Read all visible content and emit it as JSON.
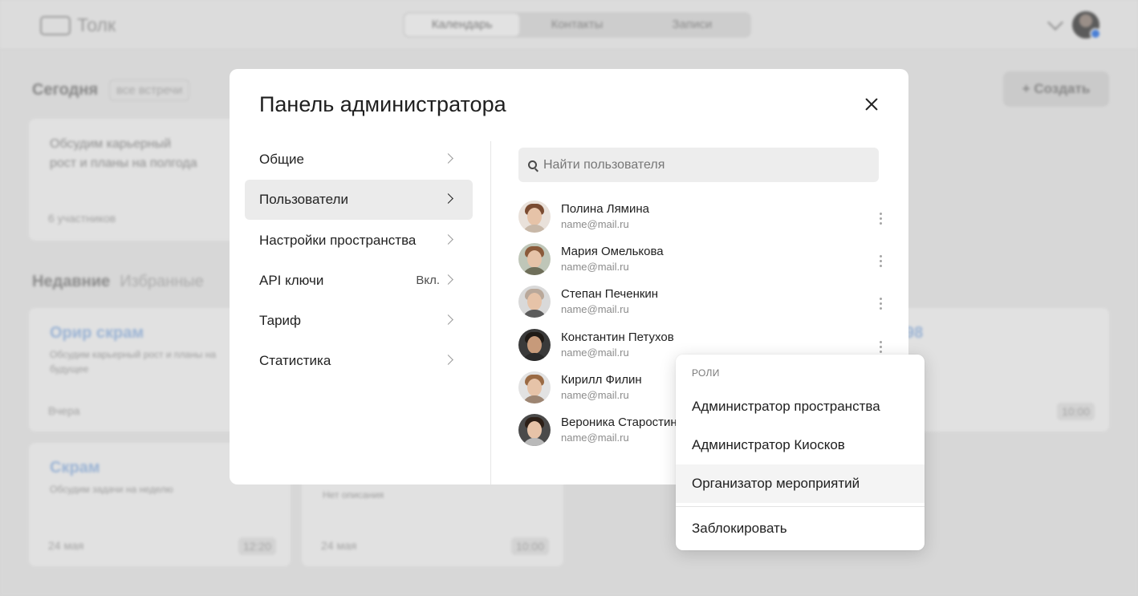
{
  "app": {
    "logo_text": "Толк",
    "tabs": [
      "Календарь",
      "Контакты",
      "Записи"
    ],
    "today_label": "Сегодня",
    "filter_label": "все встречи",
    "create_label": "+ Создать",
    "first_card": {
      "title_line1": "Обсудим карьерный",
      "title_line2": "рост и планы на полгода",
      "participants": "6 участников"
    },
    "recent_label": "Недавние",
    "favorites_label": "Избранные",
    "cards": [
      {
        "title": "Орир скрам",
        "desc": "Обсудим карьерный рост и планы на будущее",
        "date": "Вчера"
      },
      {
        "title": "Скрам",
        "desc": "Обсудим задачи на неделю",
        "date": "24 мая",
        "time": "12:20"
      },
      {
        "title": "",
        "desc": "Нет описания",
        "date": "24 мая",
        "time": "10:00"
      },
      {
        "title": "98",
        "desc": "",
        "date": "",
        "time": "10:00"
      }
    ]
  },
  "modal": {
    "title": "Панель администратора",
    "menu": [
      {
        "label": "Общие",
        "badge": ""
      },
      {
        "label": "Пользователи",
        "badge": ""
      },
      {
        "label": "Настройки пространства",
        "badge": ""
      },
      {
        "label": "API ключи",
        "badge": "Вкл."
      },
      {
        "label": "Тариф",
        "badge": ""
      },
      {
        "label": "Статистика",
        "badge": ""
      }
    ],
    "active_menu": "Пользователи",
    "search_placeholder": "Найти пользователя",
    "users": [
      {
        "name": "Полина Лямина",
        "email": "name@mail.ru"
      },
      {
        "name": "Мария Омелькова",
        "email": "name@mail.ru"
      },
      {
        "name": "Степан Печенкин",
        "email": "name@mail.ru"
      },
      {
        "name": "Константин Петухов",
        "email": "name@mail.ru"
      },
      {
        "name": "Кирилл Филин",
        "email": "name@mail.ru"
      },
      {
        "name": "Вероника Старостина",
        "email": "name@mail.ru"
      }
    ]
  },
  "dropdown": {
    "header": "РОЛИ",
    "items": [
      "Администратор пространства",
      "Администратор Киосков",
      "Организатор мероприятий"
    ],
    "block_label": "Заблокировать",
    "highlighted": "Организатор мероприятий"
  },
  "colors": {
    "accent": "#4a7fd6",
    "overlay": "#d6d6d6",
    "modal_bg": "#ffffff",
    "active_item": "#ebebeb"
  }
}
